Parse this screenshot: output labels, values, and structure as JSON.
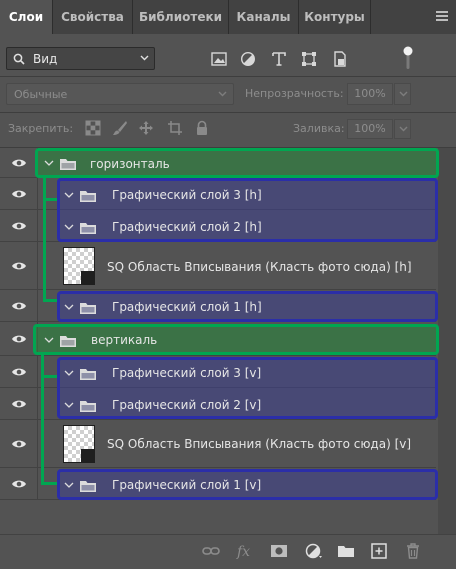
{
  "tabs": [
    {
      "label": "Слои",
      "active": true
    },
    {
      "label": "Свойства",
      "active": false
    },
    {
      "label": "Библиотеки",
      "active": false
    },
    {
      "label": "Каналы",
      "active": false
    },
    {
      "label": "Контуры",
      "active": false
    }
  ],
  "filter": {
    "kind_label": "Вид",
    "icons": [
      "image-filter-icon",
      "adjustment-filter-icon",
      "type-filter-icon",
      "shape-filter-icon",
      "smart-object-filter-icon"
    ]
  },
  "blend": {
    "mode": "Обычные",
    "opacity_label": "Непрозрачность:",
    "opacity_value": "100%"
  },
  "lock": {
    "label": "Закрепить:",
    "fill_label": "Заливка:",
    "fill_value": "100%"
  },
  "layers": [
    {
      "type": "group",
      "name": "горизонталь",
      "level": 0
    },
    {
      "type": "group",
      "name": "Графический слой 3 [h]",
      "level": 1
    },
    {
      "type": "group",
      "name": "Графический слой 2 [h]",
      "level": 1
    },
    {
      "type": "smart",
      "name": "SQ Область Вписывания (Класть фото сюда) [h]",
      "level": 1
    },
    {
      "type": "group",
      "name": "Графический слой 1 [h]",
      "level": 1
    },
    {
      "type": "group",
      "name": "вертикаль",
      "level": 0
    },
    {
      "type": "group",
      "name": "Графический слой 3 [v]",
      "level": 1
    },
    {
      "type": "group",
      "name": "Графический слой 2 [v]",
      "level": 1
    },
    {
      "type": "smart",
      "name": "SQ Область Вписывания (Класть фото сюда) [v]",
      "level": 1
    },
    {
      "type": "group",
      "name": "Графический слой 1 [v]",
      "level": 1
    }
  ],
  "bottom_icons": [
    "link-layers-icon",
    "fx-icon",
    "add-mask-icon",
    "adjustment-layer-icon",
    "new-group-icon",
    "new-layer-icon",
    "delete-layer-icon"
  ],
  "colors": {
    "panel_bg": "#535353",
    "tabbar_bg": "#424242",
    "highlight_green": "#00a651",
    "highlight_blue": "#2b2ea8"
  }
}
